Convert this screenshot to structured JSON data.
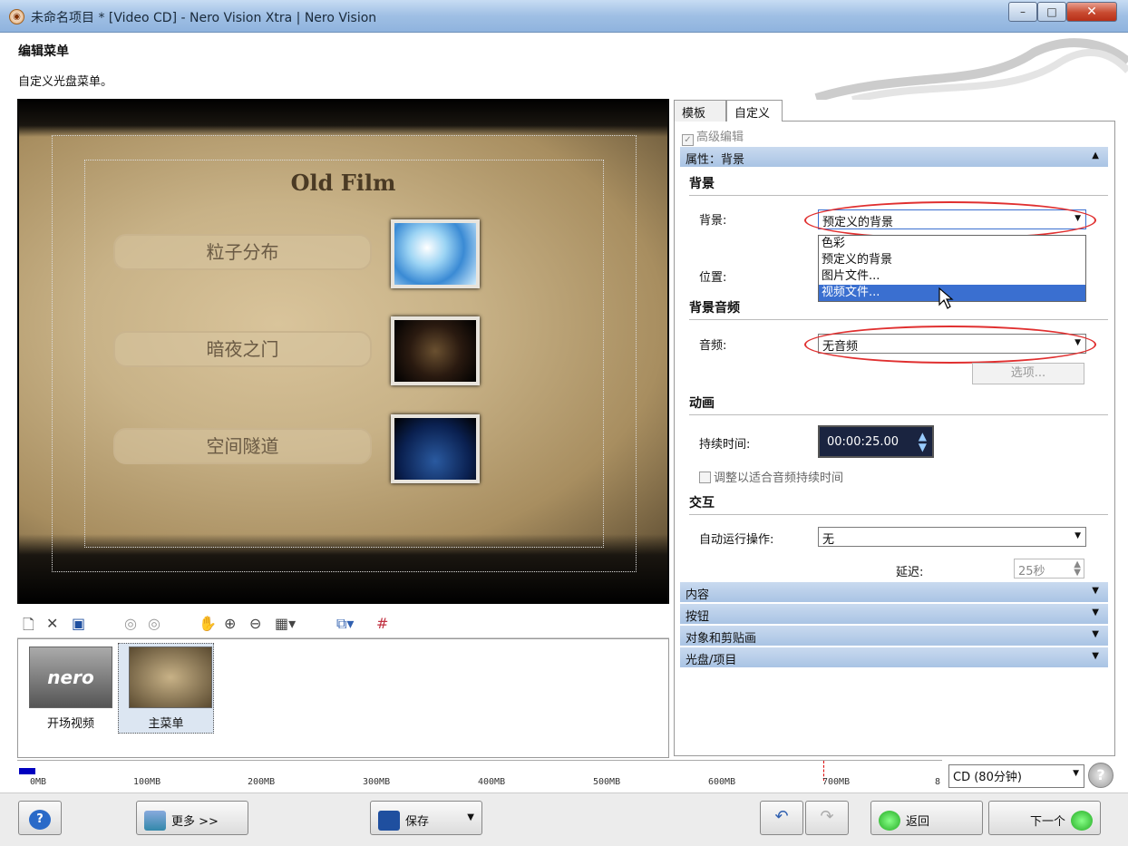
{
  "window": {
    "title": "未命名项目 * [Video CD] - Nero Vision Xtra | Nero Vision",
    "min": "–",
    "max": "□",
    "close": "✕"
  },
  "page": {
    "heading": "编辑菜单",
    "subtitle": "自定义光盘菜单。"
  },
  "preview": {
    "menu_title": "Old Film",
    "buttons": [
      "粒子分布",
      "暗夜之门",
      "空间隧道"
    ]
  },
  "thumbnails": [
    {
      "label": "开场视频",
      "logo": "nero"
    },
    {
      "label": "主菜单"
    }
  ],
  "tabs": [
    "模板",
    "自定义"
  ],
  "panel": {
    "advanced_edit": "高级编辑",
    "prop_header": "属性：背景",
    "bg_group": "背景",
    "bg_label": "背景:",
    "bg_value": "预定义的背景",
    "bg_options": [
      "色彩",
      "预定义的背景",
      "图片文件...",
      "视频文件..."
    ],
    "position_label": "位置:",
    "audio_group": "背景音频",
    "audio_label": "音频:",
    "audio_value": "无音频",
    "options_button": "选项...",
    "anim_group": "动画",
    "duration_label": "持续时间:",
    "duration_value": "00:00:25.00",
    "fit_audio": "调整以适合音频持续时间",
    "interact_group": "交互",
    "autorun_label": "自动运行操作:",
    "autorun_value": "无",
    "delay_label": "延迟:",
    "delay_value": "25秒",
    "collapsed": [
      "内容",
      "按钮",
      "对象和剪贴画",
      "光盘/项目"
    ]
  },
  "ruler": {
    "ticks": [
      "0MB",
      "100MB",
      "200MB",
      "300MB",
      "400MB",
      "500MB",
      "600MB",
      "700MB",
      "8"
    ],
    "disc": "CD (80分钟)"
  },
  "bottom": {
    "help": "?",
    "more": "更多 >>",
    "save": "保存",
    "back": "返回",
    "next": "下一个"
  },
  "colors": {
    "accent": "#3a6fd0",
    "header": "#b8cfe9",
    "highlight_ring": "#e03030"
  }
}
